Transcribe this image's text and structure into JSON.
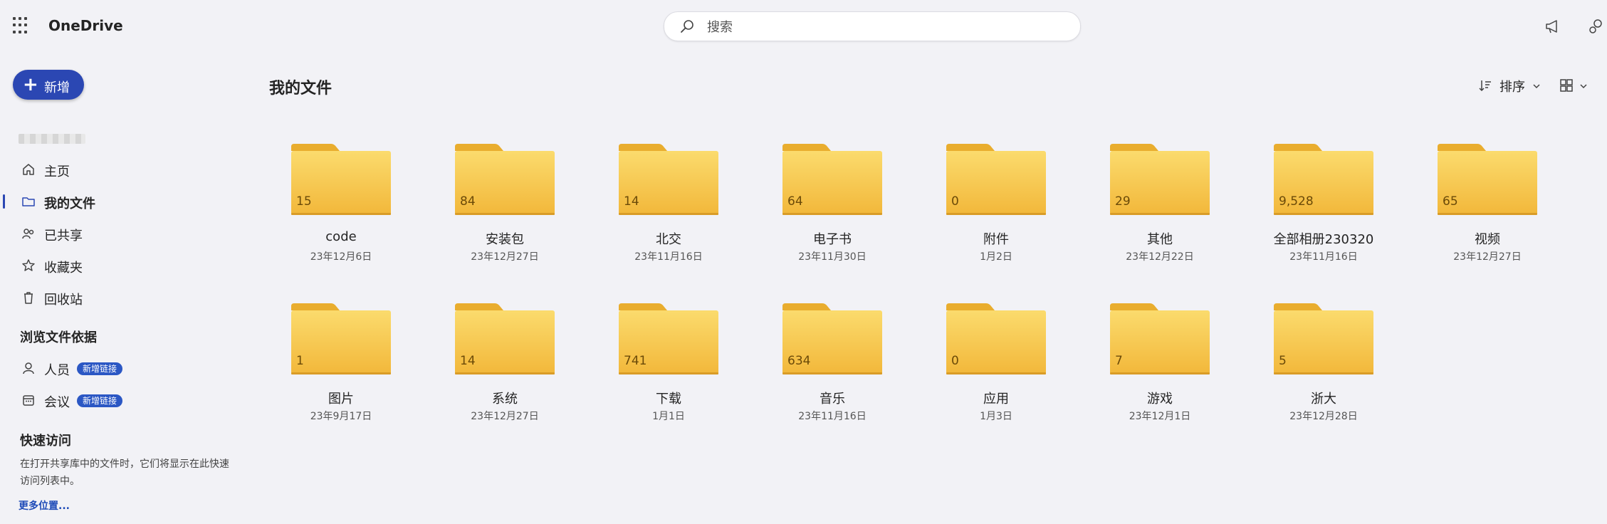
{
  "app": {
    "name": "OneDrive"
  },
  "search": {
    "placeholder": "搜索"
  },
  "sidebar": {
    "new_label": "新增",
    "items": [
      {
        "label": "主页",
        "icon": "home-icon"
      },
      {
        "label": "我的文件",
        "icon": "folder-icon",
        "active": true
      },
      {
        "label": "已共享",
        "icon": "people-icon"
      },
      {
        "label": "收藏夹",
        "icon": "star-icon"
      },
      {
        "label": "回收站",
        "icon": "recycle-bin-icon"
      }
    ],
    "browse_title": "浏览文件依据",
    "browse_items": [
      {
        "label": "人员",
        "badge": "新增链接",
        "icon": "person-icon"
      },
      {
        "label": "会议",
        "badge": "新增链接",
        "icon": "calendar-icon"
      }
    ],
    "quick_access_title": "快速访问",
    "quick_access_desc": "在打开共享库中的文件时，它们将显示在此快速访问列表中。",
    "more_places": "更多位置..."
  },
  "main": {
    "title": "我的文件",
    "sort_label": "排序",
    "folders": [
      {
        "name": "code",
        "count": "15",
        "date": "23年12月6日"
      },
      {
        "name": "安装包",
        "count": "84",
        "date": "23年12月27日"
      },
      {
        "name": "北交",
        "count": "14",
        "date": "23年11月16日"
      },
      {
        "name": "电子书",
        "count": "64",
        "date": "23年11月30日"
      },
      {
        "name": "附件",
        "count": "0",
        "date": "1月2日"
      },
      {
        "name": "其他",
        "count": "29",
        "date": "23年12月22日"
      },
      {
        "name": "全部相册230320",
        "count": "9,528",
        "date": "23年11月16日"
      },
      {
        "name": "视频",
        "count": "65",
        "date": "23年12月27日"
      },
      {
        "name": "图片",
        "count": "1",
        "date": "23年9月17日"
      },
      {
        "name": "系统",
        "count": "14",
        "date": "23年12月27日"
      },
      {
        "name": "下载",
        "count": "741",
        "date": "1月1日"
      },
      {
        "name": "音乐",
        "count": "634",
        "date": "23年11月16日"
      },
      {
        "name": "应用",
        "count": "0",
        "date": "1月3日"
      },
      {
        "name": "游戏",
        "count": "7",
        "date": "23年12月1日"
      },
      {
        "name": "浙大",
        "count": "5",
        "date": "23年12月28日"
      }
    ]
  },
  "colors": {
    "accent": "#2b47b3",
    "folder": "#f5c13f",
    "background": "#f2f2f6"
  }
}
